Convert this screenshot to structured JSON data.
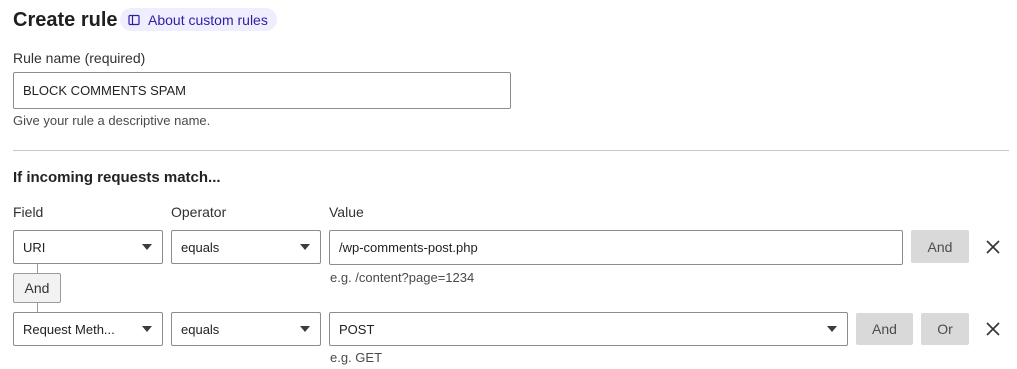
{
  "header": {
    "title": "Create rule",
    "about_label": "About custom rules"
  },
  "rule_name": {
    "label": "Rule name (required)",
    "value": "BLOCK COMMENTS SPAM",
    "help": "Give your rule a descriptive name."
  },
  "match": {
    "heading": "If incoming requests match...",
    "columns": {
      "field": "Field",
      "operator": "Operator",
      "value": "Value"
    },
    "conditions": [
      {
        "field": "URI",
        "operator": "equals",
        "value": "/wp-comments-post.php",
        "hint": "e.g. /content?page=1234",
        "and_label": "And"
      },
      {
        "field": "Request Meth...",
        "operator": "equals",
        "value": "POST",
        "hint": "e.g. GET",
        "and_label": "And",
        "or_label": "Or"
      }
    ],
    "connector_label": "And"
  },
  "icons": {
    "about": "book-icon",
    "remove": "close-icon",
    "dropdown": "chevron-down-icon"
  },
  "colors": {
    "accent": "#2c1fa6",
    "pill_bg": "#eeeefe",
    "button_bg": "#d9d9d9"
  }
}
